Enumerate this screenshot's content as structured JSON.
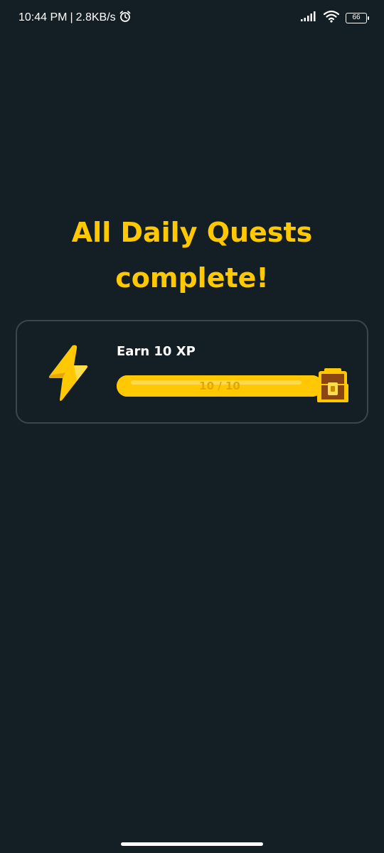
{
  "status_bar": {
    "time": "10:44 PM",
    "separator": "|",
    "network_speed": "2.8KB/s",
    "battery": "66",
    "icons": [
      "alarm-icon",
      "signal-icon",
      "wifi-icon",
      "battery-icon"
    ]
  },
  "headline": {
    "line1": "All Daily Quests",
    "line2": "complete!"
  },
  "quest": {
    "title": "Earn 10 XP",
    "progress_text": "10 / 10",
    "progress_value": 10,
    "progress_max": 10,
    "icon": "lightning-bolt-icon",
    "reward_icon": "treasure-chest-icon"
  },
  "colors": {
    "background": "#131f24",
    "accent": "#ffc800",
    "card_border": "#37464f",
    "text": "#ffffff"
  }
}
